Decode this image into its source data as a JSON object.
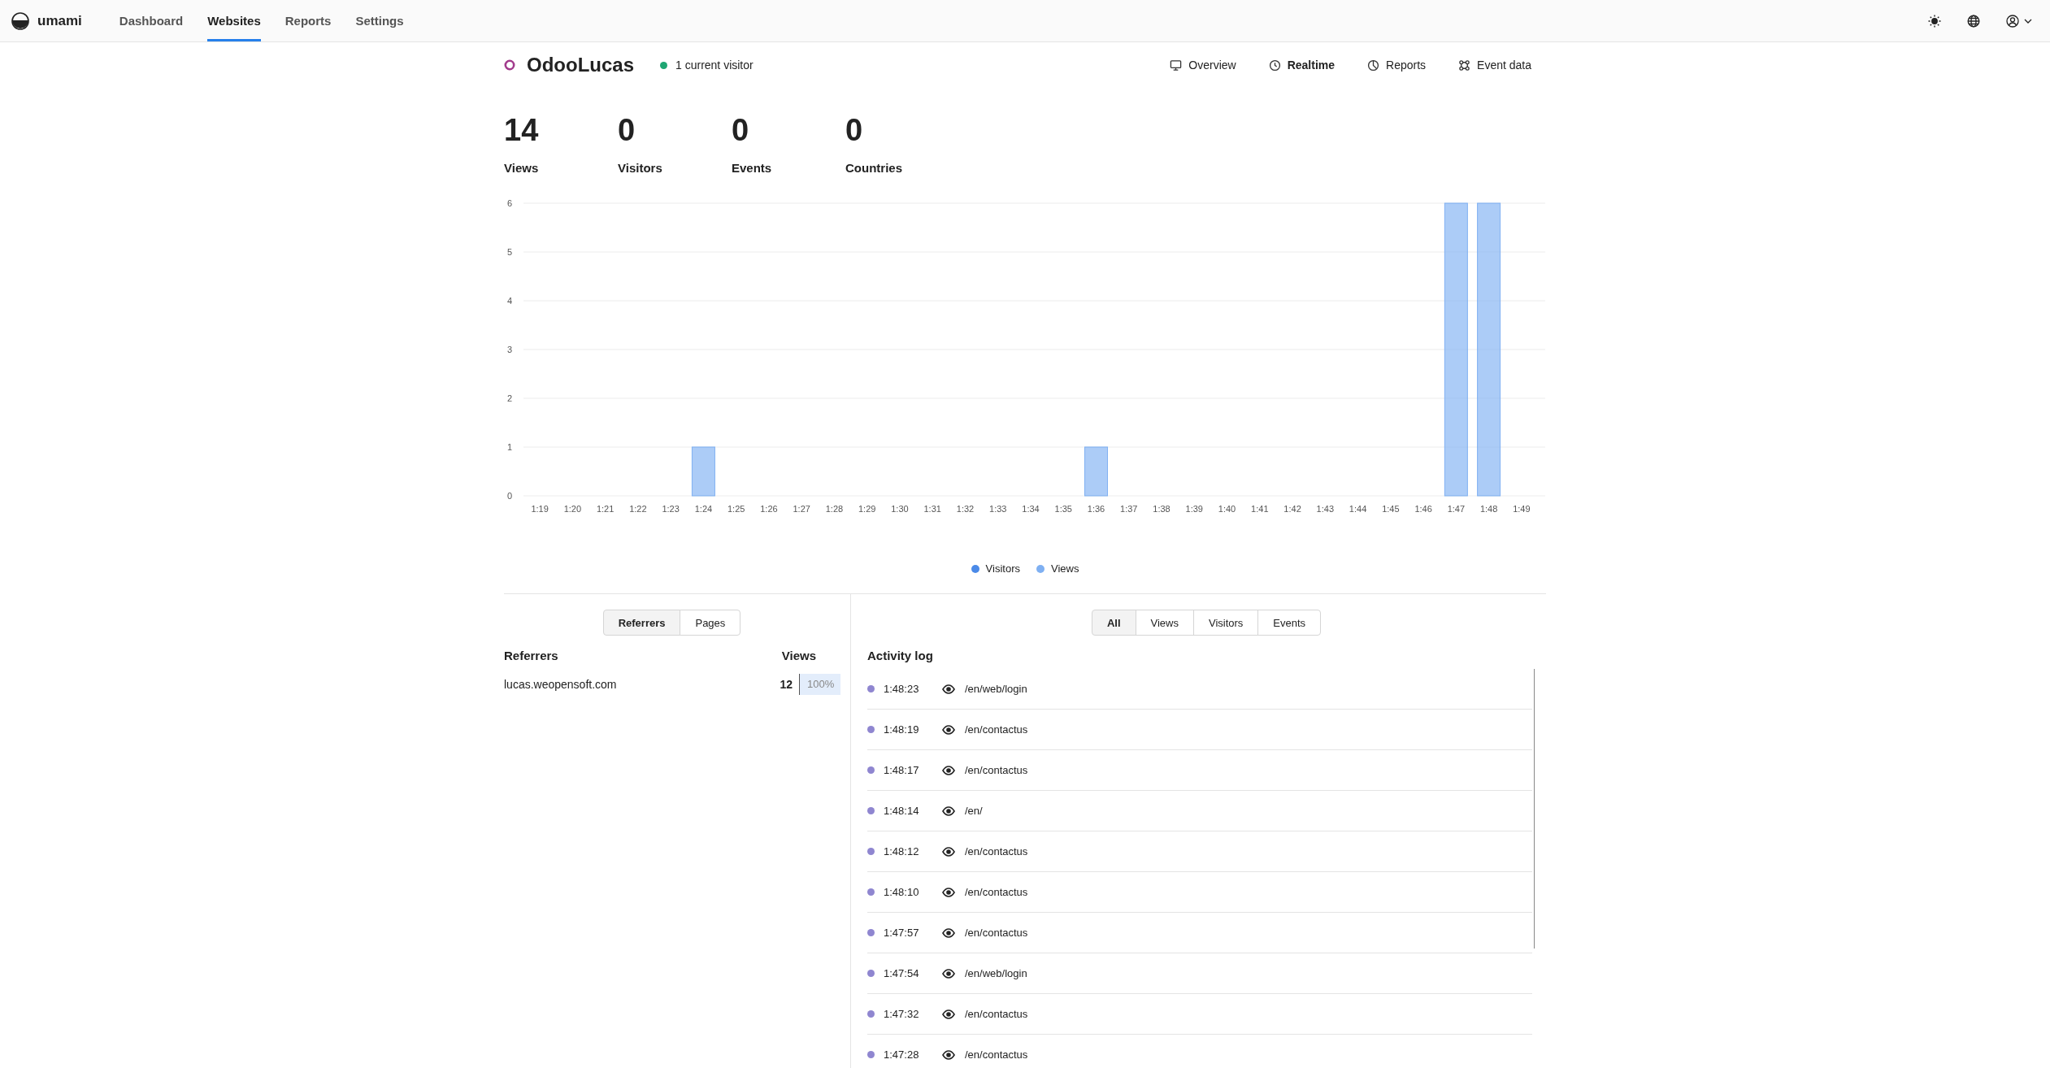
{
  "nav": {
    "logo": "umami",
    "items": [
      {
        "label": "Dashboard",
        "selected": false
      },
      {
        "label": "Websites",
        "selected": true
      },
      {
        "label": "Reports",
        "selected": false
      },
      {
        "label": "Settings",
        "selected": false
      }
    ]
  },
  "website": {
    "name": "OdooLucas",
    "visitors": "1 current visitor",
    "links": [
      {
        "label": "Overview",
        "kind": "monitor",
        "selected": false
      },
      {
        "label": "Realtime",
        "kind": "clock",
        "selected": true
      },
      {
        "label": "Reports",
        "kind": "pie",
        "selected": false
      },
      {
        "label": "Event data",
        "kind": "nodes",
        "selected": false
      }
    ]
  },
  "metrics": [
    {
      "value": "14",
      "label": "Views"
    },
    {
      "value": "0",
      "label": "Visitors"
    },
    {
      "value": "0",
      "label": "Events"
    },
    {
      "value": "0",
      "label": "Countries"
    }
  ],
  "chart_data": {
    "type": "bar",
    "categories": [
      "1:19",
      "1:20",
      "1:21",
      "1:22",
      "1:23",
      "1:24",
      "1:25",
      "1:26",
      "1:27",
      "1:28",
      "1:29",
      "1:30",
      "1:31",
      "1:32",
      "1:33",
      "1:34",
      "1:35",
      "1:36",
      "1:37",
      "1:38",
      "1:39",
      "1:40",
      "1:41",
      "1:42",
      "1:43",
      "1:44",
      "1:45",
      "1:46",
      "1:47",
      "1:48",
      "1:49"
    ],
    "ylim": [
      0,
      6
    ],
    "yticks": [
      0,
      1,
      2,
      3,
      4,
      5,
      6
    ],
    "stacked": true,
    "grid": true,
    "series": [
      {
        "name": "Visitors",
        "color": "#4b8ae8",
        "values": [
          0,
          0,
          0,
          0,
          0,
          0,
          0,
          0,
          0,
          0,
          0,
          0,
          0,
          0,
          0,
          0,
          0,
          0,
          0,
          0,
          0,
          0,
          0,
          0,
          0,
          0,
          0,
          0,
          0,
          0,
          0
        ]
      },
      {
        "name": "Views",
        "color": "#7fb0f2",
        "values": [
          0,
          0,
          0,
          0,
          0,
          1,
          0,
          0,
          0,
          0,
          0,
          0,
          0,
          0,
          0,
          0,
          0,
          1,
          0,
          0,
          0,
          0,
          0,
          0,
          0,
          0,
          0,
          0,
          6,
          6,
          0
        ]
      }
    ]
  },
  "referrers": {
    "tabs": [
      {
        "label": "Referrers",
        "selected": true
      },
      {
        "label": "Pages",
        "selected": false
      }
    ],
    "column_1": "Referrers",
    "column_2": "Views",
    "rows": [
      {
        "name": "lucas.weopensoft.com",
        "views": "12",
        "percent": "100%",
        "level": 1
      }
    ]
  },
  "activity": {
    "tabs": [
      {
        "label": "All",
        "selected": true
      },
      {
        "label": "Views",
        "selected": false
      },
      {
        "label": "Visitors",
        "selected": false
      },
      {
        "label": "Events",
        "selected": false
      }
    ],
    "title": "Activity log",
    "rows": [
      {
        "kind": "view",
        "time": "1:48:23",
        "path": "/en/web/login"
      },
      {
        "kind": "view",
        "time": "1:48:19",
        "path": "/en/contactus"
      },
      {
        "kind": "view",
        "time": "1:48:17",
        "path": "/en/contactus"
      },
      {
        "kind": "view",
        "time": "1:48:14",
        "path": "/en/"
      },
      {
        "kind": "view",
        "time": "1:48:12",
        "path": "/en/contactus"
      },
      {
        "kind": "view",
        "time": "1:48:10",
        "path": "/en/contactus"
      },
      {
        "kind": "view",
        "time": "1:47:57",
        "path": "/en/contactus"
      },
      {
        "kind": "view",
        "time": "1:47:54",
        "path": "/en/web/login"
      },
      {
        "kind": "view",
        "time": "1:47:32",
        "path": "/en/contactus"
      },
      {
        "kind": "view",
        "time": "1:47:28",
        "path": "/en/contactus"
      }
    ]
  }
}
